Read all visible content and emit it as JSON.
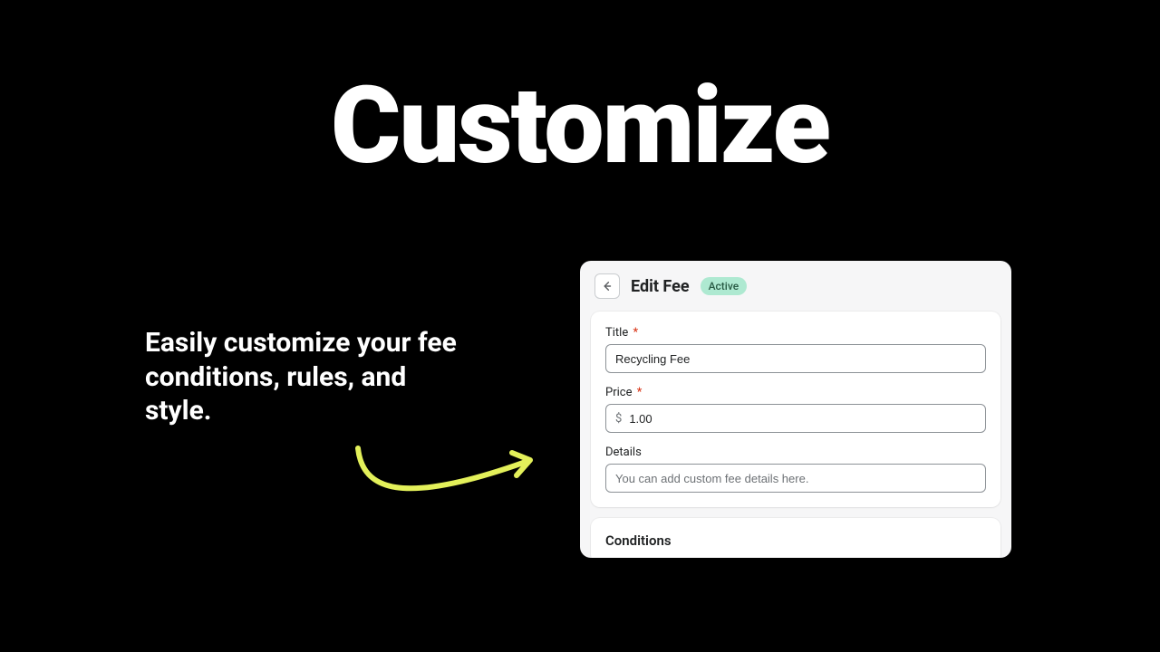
{
  "hero": {
    "title": "Customize",
    "subtitle": "Easily customize your fee conditions, rules, and style."
  },
  "panel": {
    "title": "Edit Fee",
    "badge": "Active",
    "fields": {
      "title": {
        "label": "Title",
        "value": "Recycling Fee"
      },
      "price": {
        "label": "Price",
        "currency": "$",
        "value": "1.00"
      },
      "details": {
        "label": "Details",
        "placeholder": "You can add custom fee details here."
      }
    },
    "conditions": {
      "title": "Conditions"
    }
  },
  "required_marker": "*",
  "colors": {
    "arrow": "#e3f05a",
    "badge_bg": "#aee9d1"
  }
}
